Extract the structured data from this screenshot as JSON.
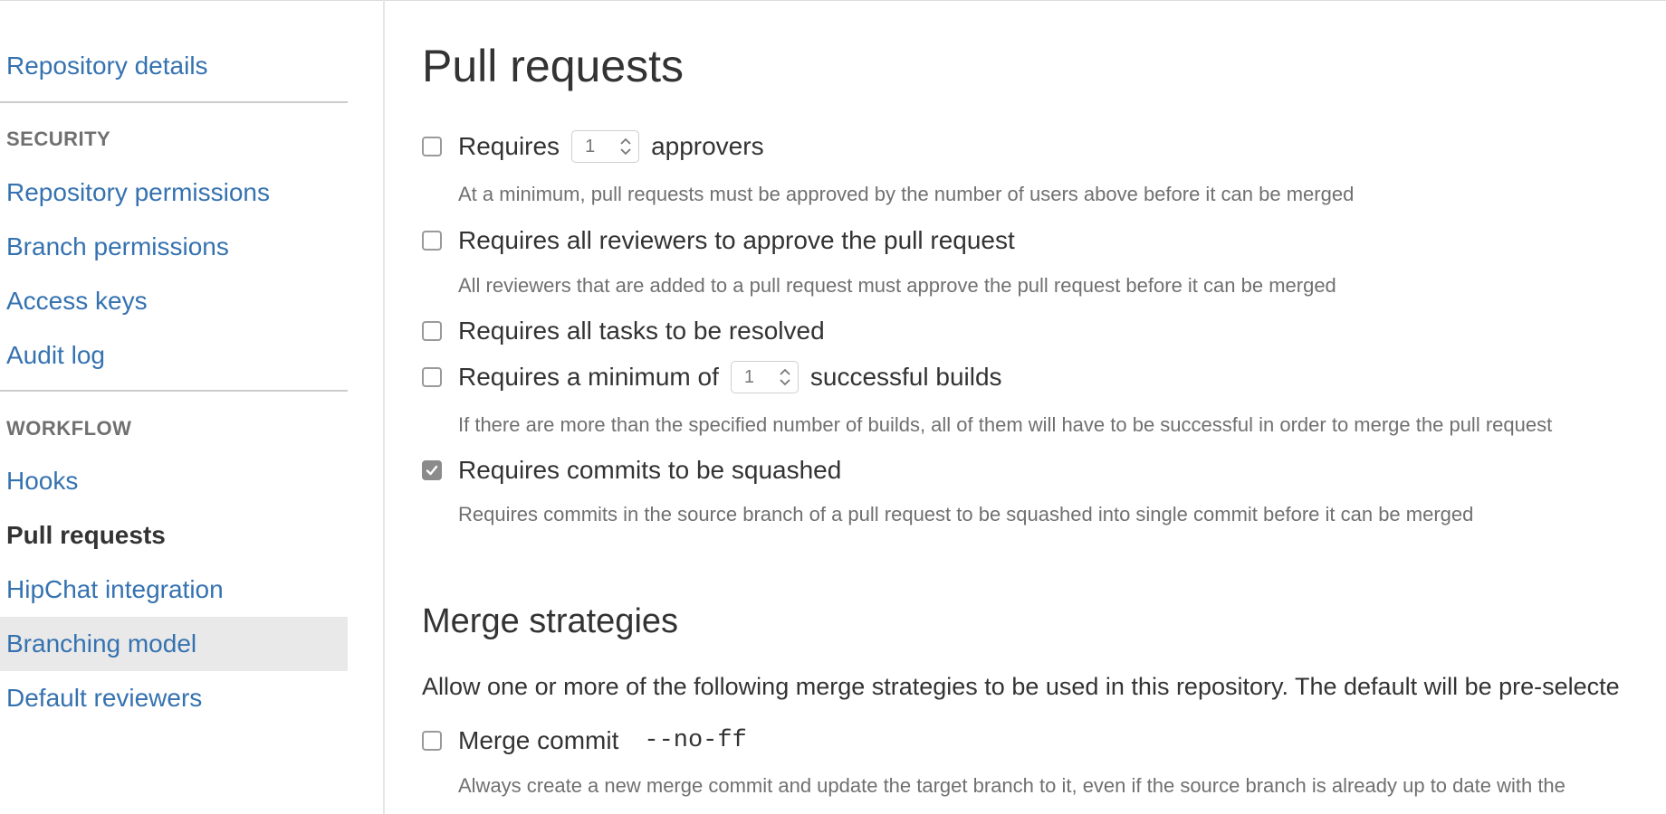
{
  "sidebar": {
    "repository_details": "Repository details",
    "security_heading": "SECURITY",
    "security_items": [
      "Repository permissions",
      "Branch permissions",
      "Access keys",
      "Audit log"
    ],
    "workflow_heading": "WORKFLOW",
    "workflow_items": [
      "Hooks",
      "Pull requests",
      "HipChat integration",
      "Branching model",
      "Default reviewers"
    ],
    "active_item": "Pull requests",
    "hovered_item": "Branching model"
  },
  "pull_requests": {
    "title": "Pull requests",
    "approvers": {
      "checked": false,
      "label_before": "Requires",
      "value": "1",
      "label_after": "approvers",
      "description": "At a minimum, pull requests must be approved by the number of users above before it can be merged"
    },
    "all_reviewers": {
      "checked": false,
      "label": "Requires all reviewers to approve the pull request",
      "description": "All reviewers that are added to a pull request must approve the pull request before it can be merged"
    },
    "tasks": {
      "checked": false,
      "label": "Requires all tasks to be resolved"
    },
    "builds": {
      "checked": false,
      "label_before": "Requires a minimum of",
      "value": "1",
      "label_after": "successful builds",
      "description": "If there are more than the specified number of builds, all of them will have to be successful in order to merge the pull request"
    },
    "squash": {
      "checked": true,
      "label": "Requires commits to be squashed",
      "description": "Requires commits in the source branch of a pull request to be squashed into single commit before it can be merged"
    }
  },
  "merge_strategies": {
    "title": "Merge strategies",
    "intro": "Allow one or more of the following merge strategies to be used in this repository. The default will be pre-selecte",
    "merge_commit": {
      "checked": false,
      "label": "Merge commit",
      "flag": "--no-ff",
      "description": "Always create a new merge commit and update the target branch to it, even if the source branch is already up to date with the"
    }
  },
  "colors": {
    "link": "#3572b0",
    "text": "#333333",
    "muted": "#707070",
    "checked_box": "#8b8b8b",
    "active_bg": "#e9e9e9"
  }
}
